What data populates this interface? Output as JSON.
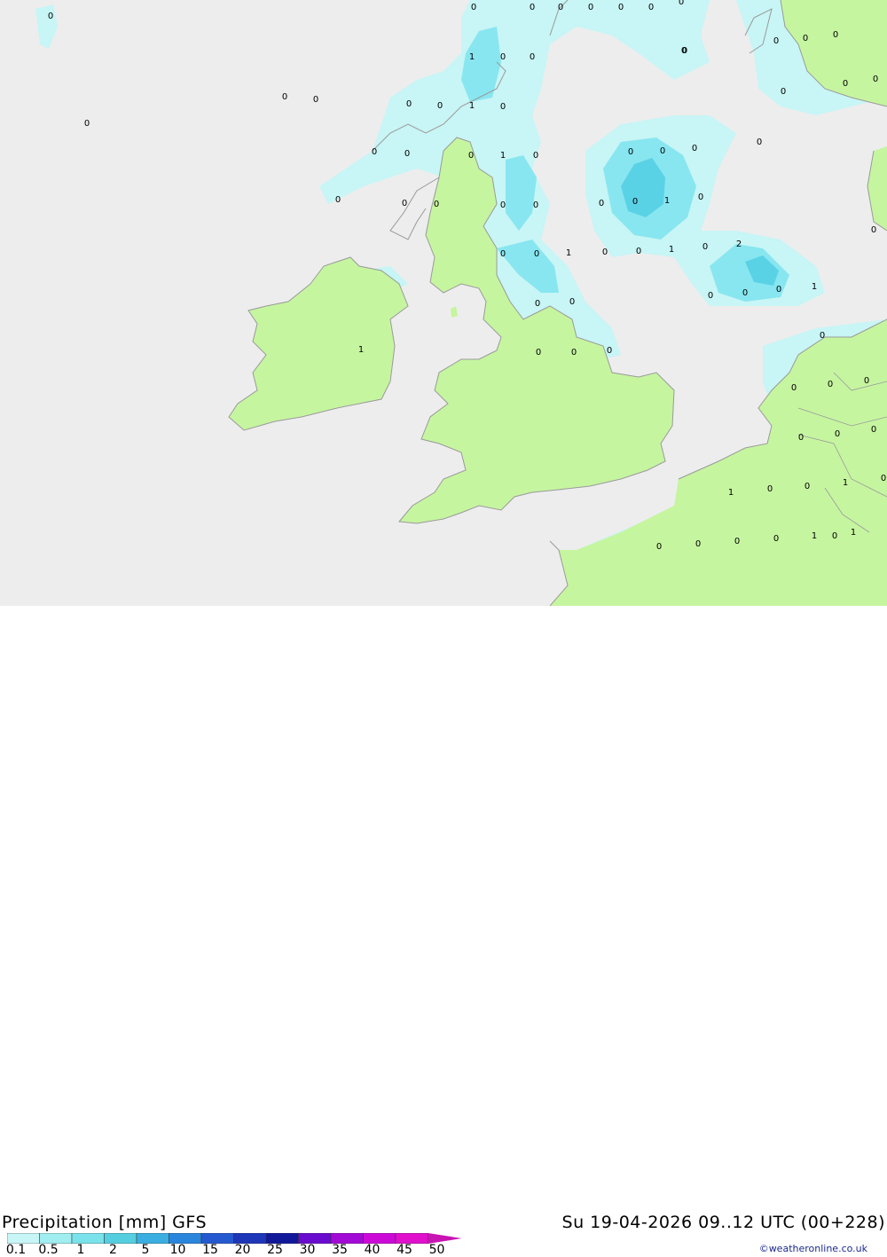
{
  "title": "Precipitation [mm] GFS",
  "datetime": "Su 19-04-2026 09..12 UTC (00+228)",
  "credit": "©weatheronline.co.uk",
  "legend": {
    "ticks": [
      "0.1",
      "0.5",
      "1",
      "2",
      "5",
      "10",
      "15",
      "20",
      "25",
      "30",
      "35",
      "40",
      "45",
      "50"
    ],
    "colors": [
      "#c8f5f5",
      "#a0eef0",
      "#7ae2ea",
      "#55cfe0",
      "#3aaee0",
      "#2a86dc",
      "#2459cf",
      "#1e36b8",
      "#12189a",
      "#6a0ccf",
      "#a20ad6",
      "#cc0ad8",
      "#e010cc",
      "#c814b2"
    ]
  },
  "map": {
    "colors": {
      "sea": "#ededed",
      "land": "#c6f5a0",
      "light_precip": "#c8f5f5",
      "mid_precip": "#88e6f0",
      "heavy_precip": "#5ad2e6",
      "coast": "#9a9a9a"
    },
    "values": [
      {
        "t": "0"
      },
      {
        "t": "0"
      },
      {
        "t": "0"
      },
      {
        "t": "0"
      },
      {
        "t": "0"
      },
      {
        "t": "0"
      },
      {
        "t": "0"
      },
      {
        "t": "0"
      },
      {
        "t": "0"
      },
      {
        "t": "0"
      },
      {
        "t": "1"
      },
      {
        "t": "0"
      },
      {
        "t": "0"
      },
      {
        "t": "0"
      },
      {
        "t": "0"
      },
      {
        "t": "0"
      },
      {
        "t": "0"
      },
      {
        "t": "1"
      },
      {
        "t": "0"
      },
      {
        "t": "0"
      },
      {
        "t": "0"
      },
      {
        "t": "0"
      },
      {
        "t": "0"
      },
      {
        "t": "0"
      },
      {
        "t": "0"
      },
      {
        "t": "0"
      },
      {
        "t": "1"
      },
      {
        "t": "0"
      },
      {
        "t": "0"
      },
      {
        "t": "0"
      },
      {
        "t": "0"
      },
      {
        "t": "1"
      },
      {
        "t": "0"
      },
      {
        "t": "0"
      },
      {
        "t": "0"
      },
      {
        "t": "0"
      },
      {
        "t": "0"
      },
      {
        "t": "0"
      },
      {
        "t": "0"
      },
      {
        "t": "2"
      },
      {
        "t": "1"
      },
      {
        "t": "0"
      },
      {
        "t": "0"
      },
      {
        "t": "1"
      },
      {
        "t": "0"
      },
      {
        "t": "0"
      },
      {
        "t": "0"
      },
      {
        "t": "0"
      },
      {
        "t": "1"
      },
      {
        "t": "0"
      },
      {
        "t": "0"
      },
      {
        "t": "1"
      },
      {
        "t": "0"
      },
      {
        "t": "0"
      },
      {
        "t": "0"
      },
      {
        "t": "0"
      },
      {
        "t": "0"
      },
      {
        "t": "0"
      },
      {
        "t": "0"
      },
      {
        "t": "0"
      },
      {
        "t": "0"
      },
      {
        "t": "0"
      },
      {
        "t": "1"
      },
      {
        "t": "0"
      },
      {
        "t": "0"
      },
      {
        "t": "1"
      },
      {
        "t": "0"
      },
      {
        "t": "0"
      },
      {
        "t": "0"
      },
      {
        "t": "0"
      },
      {
        "t": "0"
      },
      {
        "t": "1"
      },
      {
        "t": "1"
      },
      {
        "t": "0"
      },
      {
        "t": "0"
      },
      {
        "t": "0"
      },
      {
        "t": "0"
      },
      {
        "t": "0"
      },
      {
        "t": "0"
      },
      {
        "t": "0"
      },
      {
        "t": "0"
      },
      {
        "t": "0"
      }
    ]
  }
}
